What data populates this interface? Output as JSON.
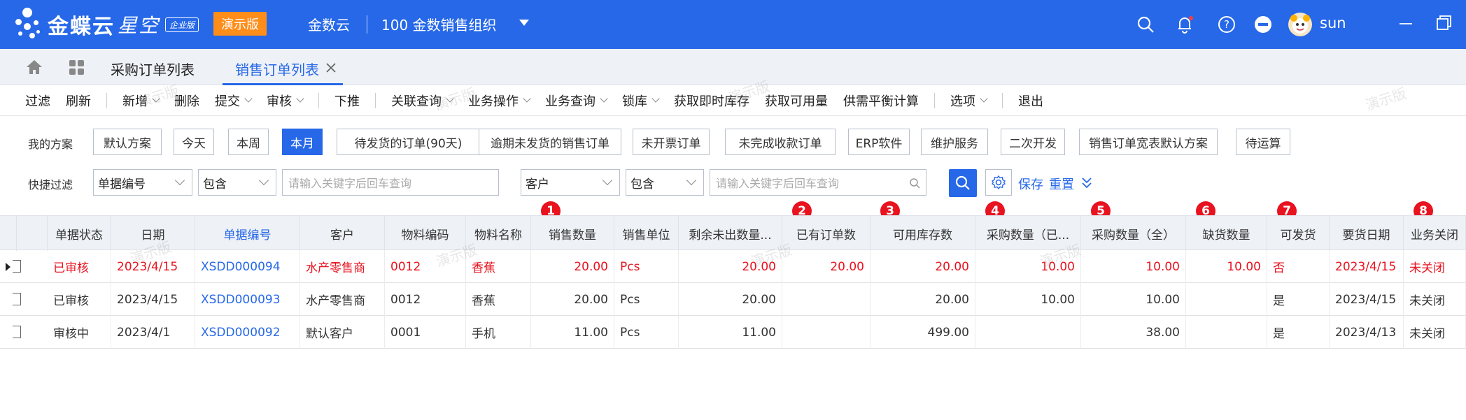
{
  "header": {
    "logo_main": "金蝶云",
    "logo_sub": "星空",
    "edition": "企业版",
    "demo_label": "演示版",
    "company": "金数云",
    "org": "100  金数销售组织",
    "user": "sun",
    "brand_color": "#2668e8"
  },
  "tabs": [
    {
      "label": "采购订单列表"
    },
    {
      "label": "销售订单列表"
    }
  ],
  "toolbar": [
    {
      "label": "过滤",
      "caret": false
    },
    {
      "label": "刷新",
      "caret": false
    },
    {
      "label": "新增",
      "caret": true
    },
    {
      "label": "删除",
      "caret": false
    },
    {
      "label": "提交",
      "caret": true
    },
    {
      "label": "审核",
      "caret": true
    },
    {
      "label": "下推",
      "caret": false
    },
    {
      "label": "关联查询",
      "caret": true
    },
    {
      "label": "业务操作",
      "caret": true
    },
    {
      "label": "业务查询",
      "caret": true
    },
    {
      "label": "锁库",
      "caret": true
    },
    {
      "label": "获取即时库存",
      "caret": false
    },
    {
      "label": "获取可用量",
      "caret": false
    },
    {
      "label": "供需平衡计算",
      "caret": false
    },
    {
      "label": "选项",
      "caret": true
    },
    {
      "label": "退出",
      "caret": false
    }
  ],
  "schemes": {
    "label": "我的方案",
    "items": [
      "默认方案",
      "今天",
      "本周",
      "本月",
      "待发货的订单(90天)",
      "逾期未发货的销售订单",
      "未开票订单",
      "未完成收款订单",
      "ERP软件",
      "维护服务",
      "二次开发",
      "销售订单宽表默认方案",
      "待运算"
    ],
    "active": "本月"
  },
  "quick_filter": {
    "label": "快捷过滤",
    "field1": "单据编号",
    "op1": "包含",
    "placeholder1": "请输入关键字后回车查询",
    "field2": "客户",
    "op2": "包含",
    "placeholder2": "请输入关键字后回车查询",
    "save": "保存",
    "reset": "重置"
  },
  "table": {
    "columns": [
      "单据状态",
      "日期",
      "单据编号",
      "客户",
      "物料编码",
      "物料名称",
      "销售数量",
      "销售单位",
      "剩余未出数量...",
      "已有订单数",
      "可用库存数",
      "采购数量（已...",
      "采购数量（全）",
      "缺货数量",
      "可发货",
      "要货日期",
      "业务关闭"
    ],
    "badges": [
      "1",
      "2",
      "3",
      "4",
      "5",
      "6",
      "7",
      "8"
    ],
    "rows": [
      [
        "已审核",
        "2023/4/15",
        "XSDD000094",
        "水产零售商",
        "0012",
        "香蕉",
        "20.00",
        "Pcs",
        "20.00",
        "20.00",
        "20.00",
        "10.00",
        "10.00",
        "10.00",
        "否",
        "2023/4/15",
        "未关闭"
      ],
      [
        "已审核",
        "2023/4/15",
        "XSDD000093",
        "水产零售商",
        "0012",
        "香蕉",
        "20.00",
        "Pcs",
        "20.00",
        "",
        "20.00",
        "10.00",
        "10.00",
        "",
        "是",
        "2023/4/15",
        "未关闭"
      ],
      [
        "审核中",
        "2023/4/1",
        "XSDD000092",
        "默认客户",
        "0001",
        "手机",
        "11.00",
        "Pcs",
        "11.00",
        "",
        "499.00",
        "",
        "38.00",
        "",
        "是",
        "2023/4/13",
        "未关闭"
      ]
    ]
  },
  "watermark": "演示版"
}
